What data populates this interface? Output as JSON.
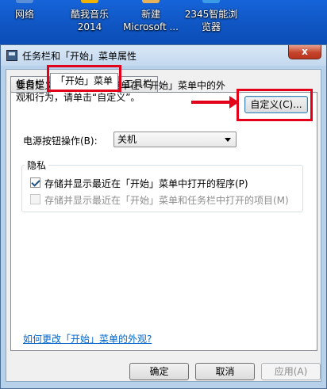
{
  "desktop": {
    "icons": [
      {
        "label": "网络"
      },
      {
        "label": "酷我音乐\n2014"
      },
      {
        "label": "新建\nMicrosoft ..."
      },
      {
        "label": "2345智能浏\n览器"
      }
    ]
  },
  "window": {
    "title": "任务栏和「开始」菜单属性",
    "close_label": "x"
  },
  "tabs": [
    {
      "label": "任务栏"
    },
    {
      "label": "「开始」菜单"
    },
    {
      "label": "工具栏"
    }
  ],
  "start_menu": {
    "description": "要自定义链接、图标和菜单在「开始」菜单中的外观和行为，请单击“自定义”。",
    "customize_button": "自定义(C)...",
    "power_label": "电源按钮操作(B):",
    "power_value": "关机",
    "privacy_title": "隐私",
    "privacy_items": [
      {
        "label": "存储并显示最近在「开始」菜单中打开的程序(P)",
        "checked": true,
        "enabled": true
      },
      {
        "label": "存储并显示最近在「开始」菜单和任务栏中打开的项目(M)",
        "checked": false,
        "enabled": false
      }
    ],
    "help_link": "如何更改「开始」菜单的外观?"
  },
  "buttons": {
    "ok": "确定",
    "cancel": "取消",
    "apply": "应用(A)"
  },
  "colors": {
    "highlight": "#e3001b",
    "link": "#0066cc"
  }
}
